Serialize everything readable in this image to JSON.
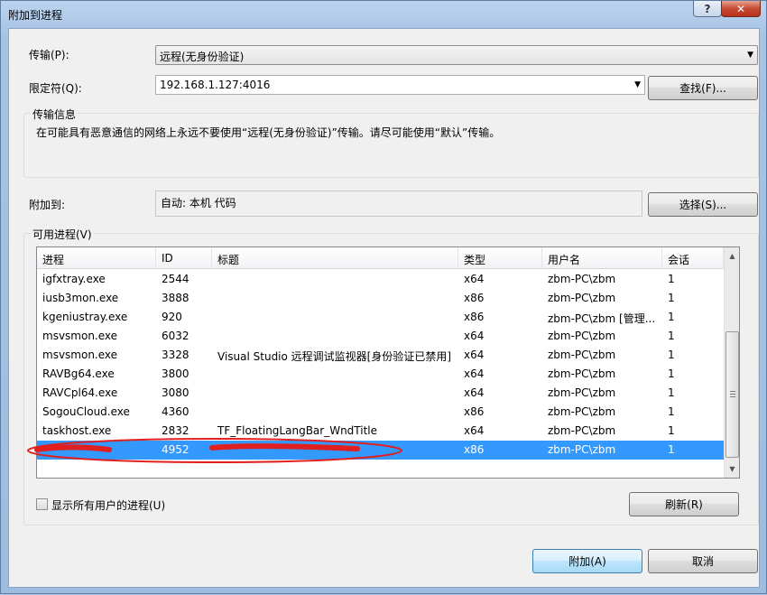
{
  "window": {
    "title": "附加到进程",
    "help": "?",
    "close": "✕"
  },
  "transport": {
    "label": "传输(P):",
    "value": "远程(无身份验证)"
  },
  "qualifier": {
    "label": "限定符(Q):",
    "value": "192.168.1.127:4016",
    "find_button": "查找(F)..."
  },
  "transport_info": {
    "title": "传输信息",
    "text": "在可能具有恶意通信的网络上永远不要使用“远程(无身份验证)”传输。请尽可能使用“默认”传输。"
  },
  "attach_to": {
    "label": "附加到:",
    "value": "自动: 本机 代码",
    "select_button": "选择(S)..."
  },
  "available": {
    "title": "可用进程(V)",
    "columns": [
      "进程",
      "ID",
      "标题",
      "类型",
      "用户名",
      "会话"
    ],
    "rows": [
      {
        "name": "igfxtray.exe",
        "id": "2544",
        "title": "",
        "type": "x64",
        "user": "zbm-PC\\zbm",
        "session": "1"
      },
      {
        "name": "iusb3mon.exe",
        "id": "3888",
        "title": "",
        "type": "x86",
        "user": "zbm-PC\\zbm",
        "session": "1"
      },
      {
        "name": "kgeniustray.exe",
        "id": "920",
        "title": "",
        "type": "x86",
        "user": "zbm-PC\\zbm [管理...",
        "session": "1"
      },
      {
        "name": "msvsmon.exe",
        "id": "6032",
        "title": "",
        "type": "x64",
        "user": "zbm-PC\\zbm",
        "session": "1"
      },
      {
        "name": "msvsmon.exe",
        "id": "3328",
        "title": "Visual Studio 远程调试监视器[身份验证已禁用]",
        "type": "x64",
        "user": "zbm-PC\\zbm",
        "session": "1"
      },
      {
        "name": "RAVBg64.exe",
        "id": "3800",
        "title": "",
        "type": "x64",
        "user": "zbm-PC\\zbm",
        "session": "1"
      },
      {
        "name": "RAVCpl64.exe",
        "id": "3080",
        "title": "",
        "type": "x64",
        "user": "zbm-PC\\zbm",
        "session": "1"
      },
      {
        "name": "SogouCloud.exe",
        "id": "4360",
        "title": "",
        "type": "x86",
        "user": "zbm-PC\\zbm",
        "session": "1"
      },
      {
        "name": "taskhost.exe",
        "id": "2832",
        "title": "TF_FloatingLangBar_WndTitle",
        "type": "x64",
        "user": "zbm-PC\\zbm",
        "session": "1"
      },
      {
        "name": "",
        "id": "4952",
        "title": "",
        "type": "x86",
        "user": "zbm-PC\\zbm",
        "session": "1"
      }
    ],
    "selected_row": 9
  },
  "show_all_users": {
    "label": "显示所有用户的进程(U)",
    "checked": false
  },
  "refresh_button": "刷新(R)",
  "attach_button": "附加(A)",
  "cancel_button": "取消",
  "colors": {
    "selection": "#3399ff",
    "annotation": "#e02020"
  }
}
